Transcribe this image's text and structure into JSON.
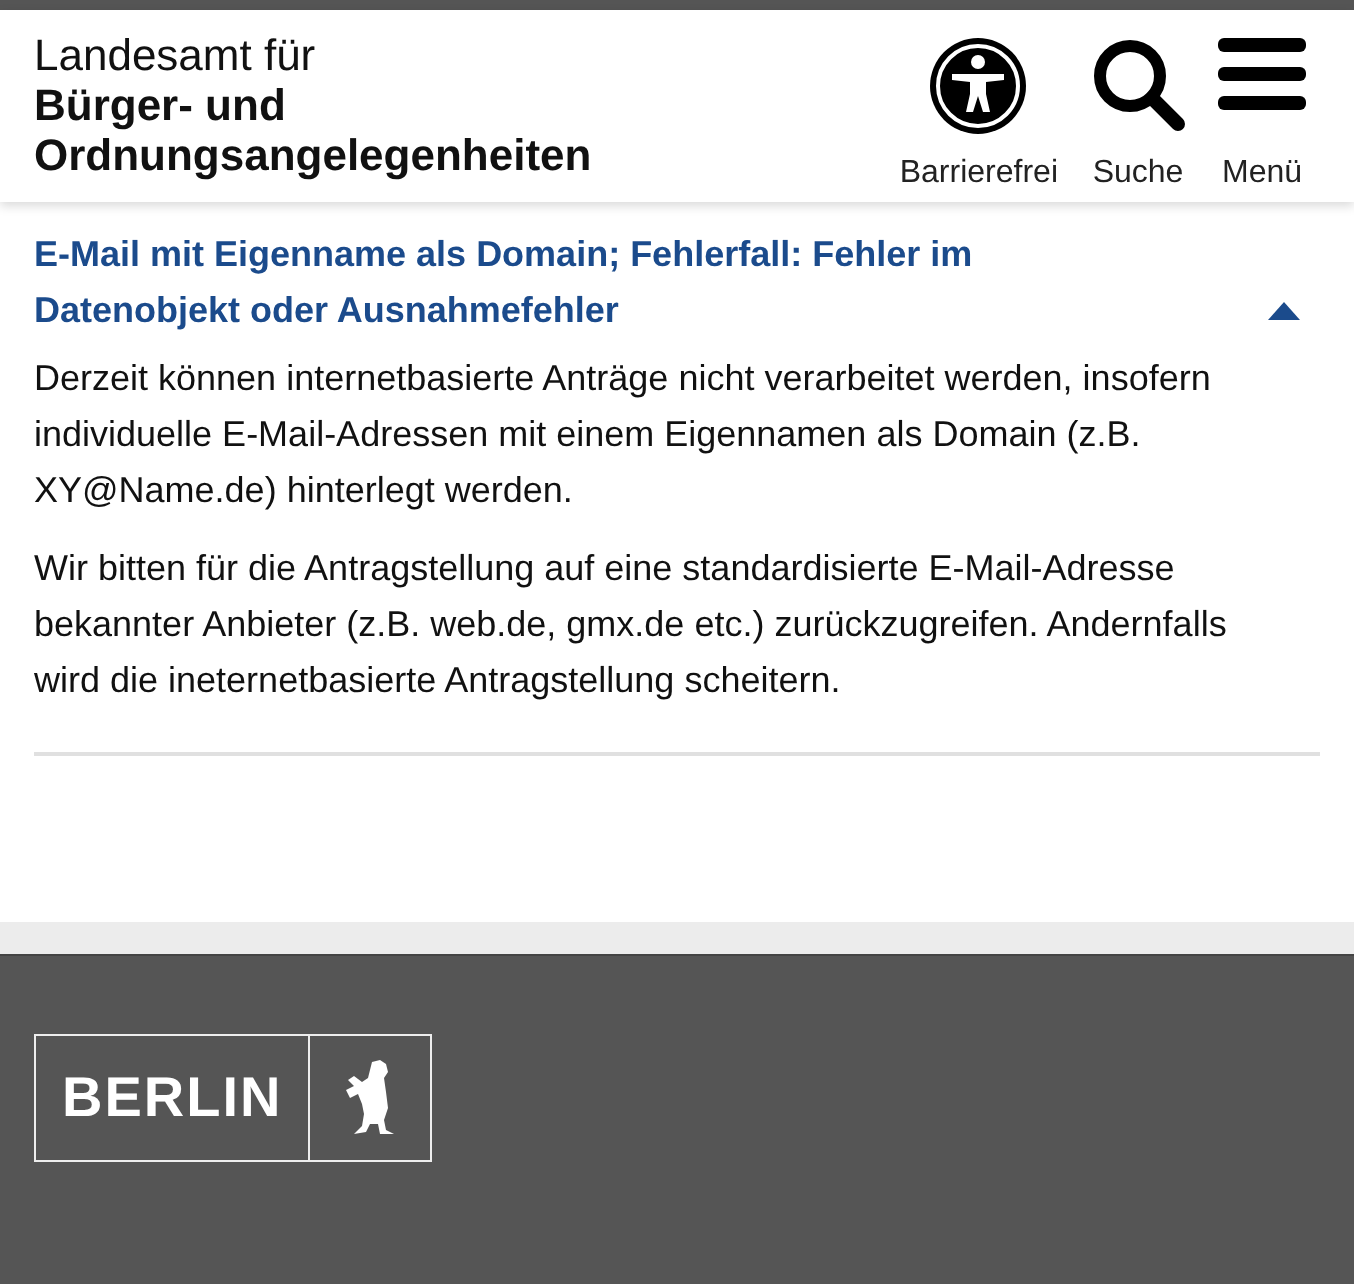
{
  "header": {
    "title_light": "Landesamt für",
    "title_bold": "Bürger- und Ordnungsangelegenheiten",
    "actions": [
      {
        "label": "Barrierefrei",
        "kind": "accessibility"
      },
      {
        "label": "Suche",
        "kind": "search"
      },
      {
        "label": "Menü",
        "kind": "menu"
      }
    ]
  },
  "accordion": {
    "title": "E-Mail mit Eigenname als Domain; Fehlerfall: Fehler im Datenobjekt oder Ausnahmefehler",
    "expanded": true,
    "paragraphs": [
      "Derzeit können internetbasierte Anträge nicht verarbeitet werden, insofern individuelle E-Mail-Adressen mit einem Eigennamen als Domain (z.B. XY@Name.de) hinterlegt werden.",
      "Wir bitten für die Antragstellung auf eine standardisierte E-Mail-Adresse bekannter Anbieter (z.B. web.de, gmx.de etc.) zurückzugreifen. Andernfalls wird die ineternetbasierte Antragstellung scheitern."
    ]
  },
  "footer": {
    "logo_text": "BERLIN"
  }
}
